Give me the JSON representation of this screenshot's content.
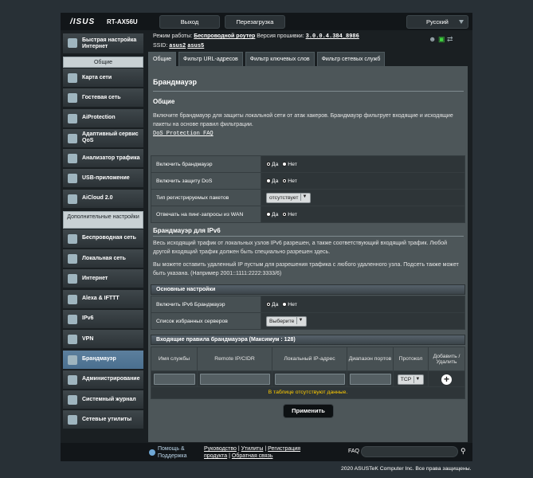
{
  "header": {
    "brand": "/ISUS",
    "model": "RT-AX56U",
    "logout_label": "Выход",
    "reboot_label": "Перезагрузка",
    "language": "Русский"
  },
  "status": {
    "mode_label": "Режим работы:",
    "mode_value": "Беспроводной роутер",
    "firmware_label": "Версия прошивки:",
    "firmware_value": "3.0.0.4.384_8986",
    "ssid_label": "SSID:",
    "ssid_1": "asus2",
    "ssid_2": "asus5"
  },
  "sidebar": {
    "quick": "Быстрая настройка Интернет",
    "general_header": "Общие",
    "general": [
      "Карта сети",
      "Гостевая сеть",
      "AiProtection",
      "Адаптивный сервис QoS",
      "Анализатор трафика",
      "USB-приложение",
      "AiCloud 2.0"
    ],
    "advanced_header": "Дополнительные настройки",
    "advanced": [
      "Беспроводная сеть",
      "Локальная сеть",
      "Интернет",
      "Alexa & IFTTT",
      "IPv6",
      "VPN",
      "Брандмауэр",
      "Администрирование",
      "Системный журнал",
      "Сетевые утилиты"
    ]
  },
  "tabs": [
    "Общие",
    "Фильтр URL-адресов",
    "Фильтр ключевых слов",
    "Фильтр сетевых служб"
  ],
  "content": {
    "title": "Брандмауэр",
    "general_title": "Общие",
    "general_desc": "Включите брандмауэр для защиты локальной сети от атак хакеров. Брандмауэр фильтрует входящие и исходящие пакеты на основе правил фильтрации.",
    "dos_link": "DoS Protection FAQ",
    "settings": [
      {
        "label": "Включить брандмауэр",
        "yes": "Да",
        "no": "Нет"
      },
      {
        "label": "Включить защиту DoS",
        "yes": "Да",
        "no": "Нет"
      },
      {
        "label": "Тип регистрируемых пакетов",
        "value": "отсутствует"
      },
      {
        "label": "Отвечать на пинг-запросы из WAN",
        "yes": "Да",
        "no": "Нет"
      }
    ],
    "ipv6_title": "Брандмауэр для IPv6",
    "ipv6_desc1": "Весь исходящий трафик от локальных узлов IPv6 разрешен, а также соответствующий входящий трафик. Любой другой входящий трафик должен быть специально разрешен здесь.",
    "ipv6_desc2": "Вы можете оставить удаленный IP пустым для разрешения трафика с любого удаленного узла. Подсеть также может быть указана. (Например 2001::1111:2222:3333/6)",
    "basic_bar": "Основные настройки",
    "ipv6_enable_label": "Включить IPv6 Брандмауэр",
    "ipv6_yes": "Да",
    "ipv6_no": "Нет",
    "server_list_label": "Список избранных серверов",
    "server_list_value": "Выберите",
    "rules_bar": "Входящие правила брандмауэра (Максимум : 128)",
    "rules_headers": [
      "Имя службы",
      "Remote IP/CIDR",
      "Локальный IP-адрес",
      "Диапазон портов",
      "Протокол",
      "Добавить / Удалить"
    ],
    "protocol_value": "TCP",
    "empty_msg": "В таблице отсутствуют данные.",
    "apply_label": "Применить"
  },
  "footer": {
    "help_1": "Помощь &",
    "help_2": "Поддержка",
    "manual": "Руководство",
    "utilities": "Утилиты",
    "registration_1": "Регистрация",
    "registration_2": "продукта",
    "feedback": "Обратная связь",
    "faq": "FAQ",
    "copyright": "2020 ASUSTeK Computer Inc. Все права защищены."
  }
}
